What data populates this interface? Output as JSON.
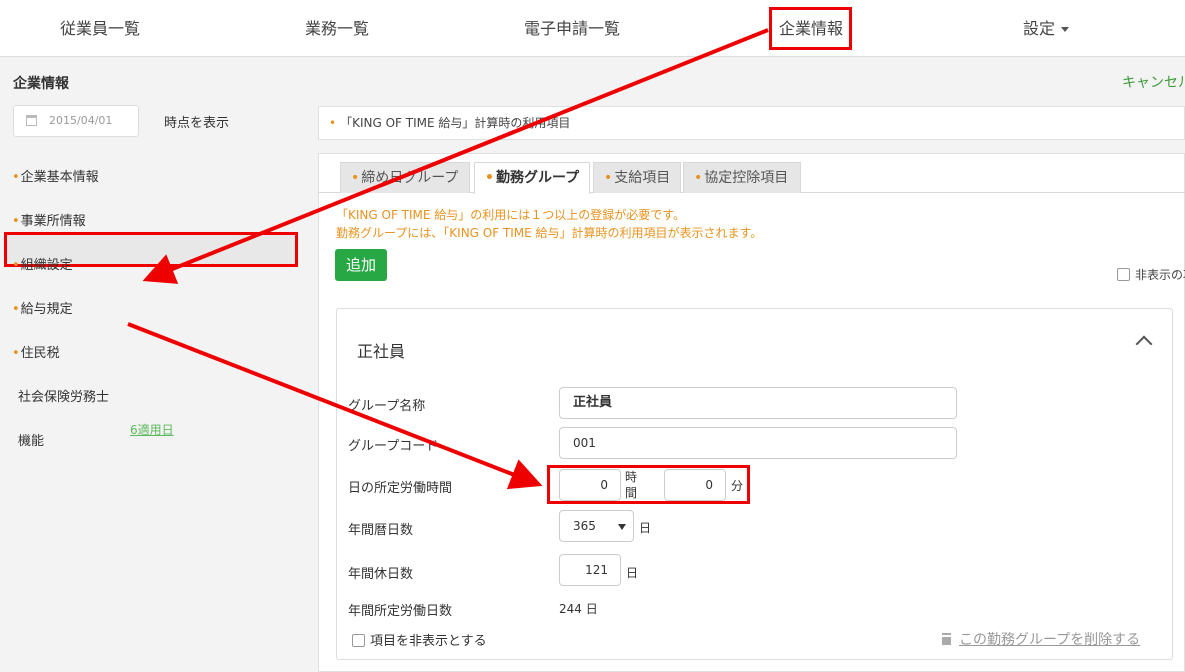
{
  "topnav": {
    "items": [
      "従業員一覧",
      "業務一覧",
      "電子申請一覧",
      "企業情報"
    ],
    "settings": "設定"
  },
  "sidebar": {
    "title": "企業情報",
    "date_value": "2015/04/01",
    "show_button": "時点を表示",
    "items": [
      "企業基本情報",
      "事業所情報",
      "組織設定",
      "給与規定",
      "住民税",
      "社会保険労務士",
      "機能"
    ],
    "apply_link": "6適用日"
  },
  "main": {
    "cancel": "キャンセル",
    "info_bar": "「KING OF TIME 給与」計算時の利用項目",
    "tabs": [
      "締め日グループ",
      "勤務グループ",
      "支給項目",
      "協定控除項目"
    ],
    "active_tab": "勤務グループ",
    "warning_1": "「KING OF TIME 給与」の利用には１つ以上の登録が必要です。",
    "warning_2": "勤務グループには、「KING OF TIME 給与」計算時の利用項目が表示されます。",
    "add_button": "追加",
    "hide_checkbox": "非表示の項目を表示",
    "card": {
      "title": "正社員",
      "group_name_label": "グループ名称",
      "group_name_value": "正社員",
      "group_code_label": "グループコード",
      "group_code_value": "001",
      "daily_hours_label": "日の所定労働時間",
      "hours_value": "0",
      "hours_unit": "時間",
      "minutes_value": "0",
      "minutes_unit": "分",
      "annual_calendar_days_label": "年間暦日数",
      "annual_calendar_days_value": "365",
      "day_unit": "日",
      "annual_holidays_label": "年間休日数",
      "annual_holidays_value": "121",
      "annual_work_days_label": "年間所定労働日数",
      "annual_work_days_value": "244 日",
      "hide_items_checkbox": "項目を非表示とする",
      "delete_link": "この勤務グループを削除する"
    }
  },
  "colors": {
    "accent_orange": "#e8921c",
    "primary_green": "#28a745",
    "annotation_red": "#ee0000"
  }
}
